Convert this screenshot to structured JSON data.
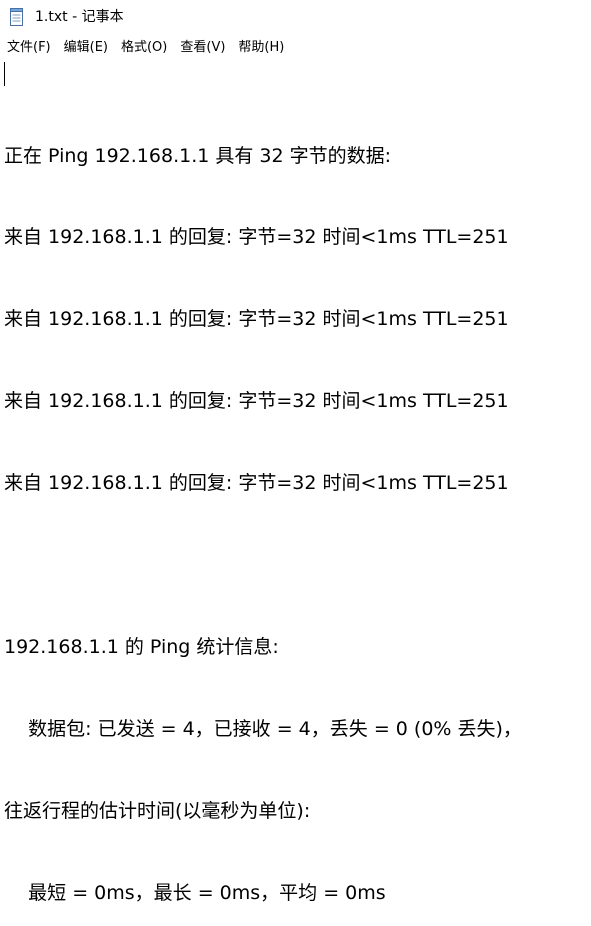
{
  "window": {
    "title": "1.txt - 记事本",
    "app_icon": "notepad-icon"
  },
  "menu": [
    {
      "label": "文件(F)"
    },
    {
      "label": "编辑(E)"
    },
    {
      "label": "格式(O)"
    },
    {
      "label": "查看(V)"
    },
    {
      "label": "帮助(H)"
    }
  ],
  "document": {
    "lines": [
      "正在 Ping 192.168.1.1 具有 32 字节的数据:",
      "来自 192.168.1.1 的回复: 字节=32 时间<1ms TTL=251",
      "来自 192.168.1.1 的回复: 字节=32 时间<1ms TTL=251",
      "来自 192.168.1.1 的回复: 字节=32 时间<1ms TTL=251",
      "来自 192.168.1.1 的回复: 字节=32 时间<1ms TTL=251",
      "",
      "192.168.1.1 的 Ping 统计信息:",
      "    数据包: 已发送 = 4，已接收 = 4，丢失 = 0 (0% 丢失)，",
      "往返行程的估计时间(以毫秒为单位):",
      "    最短 = 0ms，最长 = 0ms，平均 = 0ms"
    ]
  }
}
